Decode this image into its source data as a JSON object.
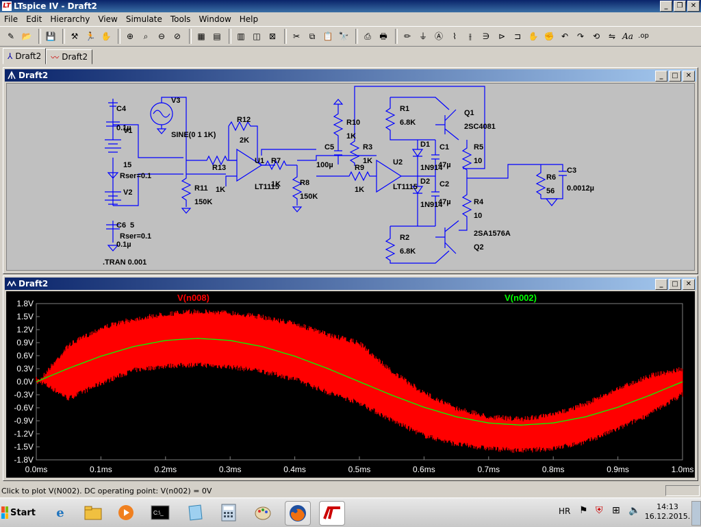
{
  "app": {
    "title": "LTspice IV - Draft2",
    "menu": [
      "File",
      "Edit",
      "Hierarchy",
      "View",
      "Simulate",
      "Tools",
      "Window",
      "Help"
    ],
    "toolbar_icons": [
      "new-schematic-icon",
      "open-icon",
      "save-icon",
      "control-panel-icon",
      "run-icon",
      "halt-icon",
      "zoom-in-icon",
      "zoom-full-icon",
      "zoom-out-icon",
      "autoscale-icon",
      "tile-icon",
      "cascade-icon",
      "close-all-icon",
      "cut-icon",
      "copy-icon",
      "paste-icon",
      "find-icon",
      "print-setup-icon",
      "print-icon",
      "wire-icon",
      "ground-icon",
      "label-icon",
      "resistor-icon",
      "capacitor-icon",
      "inductor-icon",
      "diode-icon",
      "component-icon",
      "move-icon",
      "drag-icon",
      "undo-icon",
      "redo-icon",
      "rotate-icon",
      "mirror-icon",
      "text-icon",
      "spice-directive-icon"
    ],
    "tabs": [
      {
        "label": "Draft2",
        "icon": "schematic-icon"
      },
      {
        "label": "Draft2",
        "icon": "waveform-icon"
      }
    ]
  },
  "schematic_window": {
    "title": "Draft2",
    "labels": {
      "C4": "C4",
      "C4v": "0.1µ",
      "V3": "V3",
      "V3v": "SINE(0 1 1K)",
      "V1": "V1",
      "V1v": "15",
      "V1r": "Rser=0.1",
      "V2": "V2",
      "V2r": "Rser=0.1",
      "C6": "C6",
      "C5b": "5",
      "C6v": "0.1µ",
      "tran": ".TRAN 0.001",
      "R12": "R12",
      "R12v": "2K",
      "R13": "R13",
      "R13v": "1K",
      "R11": "R11",
      "R11v": "150K",
      "U1": "U1",
      "U1v": "LT1115",
      "R7": "R7",
      "R7v": "1K",
      "R8": "R8",
      "R8v": "150K",
      "R10": "R10",
      "R10v": "1K",
      "C5": "C5",
      "C5v": "100µ",
      "R3": "R3",
      "R3v": "1K",
      "R9": "R9",
      "R9v": "1K",
      "U2": "U2",
      "U2v": "LT1115",
      "R1": "R1",
      "R1v": "6.8K",
      "D1": "D1",
      "D1v": "1N914",
      "C1": "C1",
      "C1v": "47µ",
      "D2": "D2",
      "D2v": "1N914",
      "C2": "C2",
      "C2v": "47µ",
      "R2": "R2",
      "R2v": "6.8K",
      "Q1": "Q1",
      "Q1v": "2SC4081",
      "Q2": "Q2",
      "Q2v": "2SA1576A",
      "R5": "R5",
      "R5v": "10",
      "R4": "R4",
      "R4v": "10",
      "R6": "R6",
      "R6v": "56",
      "C3": "C3",
      "C3v": "0.0012µ"
    }
  },
  "plot_window": {
    "title": "Draft2",
    "trace1_label": "V(n008)",
    "trace2_label": "V(n002)",
    "trace1_color": "#ff0000",
    "trace2_color": "#00ff00",
    "yticks": [
      "1.8V",
      "1.5V",
      "1.2V",
      "0.9V",
      "0.6V",
      "0.3V",
      "0.0V",
      "-0.3V",
      "-0.6V",
      "-0.9V",
      "-1.2V",
      "-1.5V",
      "-1.8V"
    ],
    "xticks": [
      "0.0ms",
      "0.1ms",
      "0.2ms",
      "0.3ms",
      "0.4ms",
      "0.5ms",
      "0.6ms",
      "0.7ms",
      "0.8ms",
      "0.9ms",
      "1.0ms"
    ]
  },
  "chart_data": {
    "type": "line",
    "title": "",
    "xlabel": "",
    "ylabel": "",
    "xlim": [
      0,
      1.0
    ],
    "ylim": [
      -1.8,
      1.8
    ],
    "x_unit": "ms",
    "y_unit": "V",
    "grid": false,
    "series": [
      {
        "name": "V(n008)",
        "color": "#ff0000",
        "x": [
          0.0,
          0.05,
          0.1,
          0.15,
          0.2,
          0.25,
          0.3,
          0.35,
          0.4,
          0.45,
          0.5,
          0.55,
          0.6,
          0.65,
          0.7,
          0.75,
          0.8,
          0.85,
          0.9,
          0.95,
          1.0
        ],
        "upper": [
          0.0,
          0.9,
          1.3,
          1.5,
          1.62,
          1.68,
          1.65,
          1.55,
          1.4,
          1.15,
          0.95,
          0.3,
          -0.2,
          -0.55,
          -0.75,
          -0.8,
          -0.7,
          -0.45,
          -0.1,
          0.2,
          0.35
        ],
        "lower": [
          0.0,
          -0.45,
          -0.1,
          0.2,
          0.3,
          0.33,
          0.28,
          0.18,
          0.0,
          -0.3,
          -0.55,
          -0.95,
          -1.3,
          -1.5,
          -1.6,
          -1.65,
          -1.6,
          -1.45,
          -1.15,
          -0.8,
          -0.35
        ]
      },
      {
        "name": "V(n002)",
        "color": "#00ff00",
        "x": [
          0.0,
          0.05,
          0.1,
          0.15,
          0.2,
          0.25,
          0.3,
          0.35,
          0.4,
          0.45,
          0.5,
          0.55,
          0.6,
          0.65,
          0.7,
          0.75,
          0.8,
          0.85,
          0.9,
          0.95,
          1.0
        ],
        "values": [
          0.0,
          0.309,
          0.588,
          0.809,
          0.951,
          1.0,
          0.951,
          0.809,
          0.588,
          0.309,
          0.0,
          -0.309,
          -0.588,
          -0.809,
          -0.951,
          -1.0,
          -0.951,
          -0.809,
          -0.588,
          -0.309,
          0.0
        ]
      }
    ]
  },
  "status": {
    "text": "Click to plot V(N002).  DC operating point: V(n002) = 0V"
  },
  "taskbar": {
    "start_label": "Start",
    "apps": [
      "ie-icon",
      "explorer-icon",
      "media-player-icon",
      "cmd-icon",
      "notepad-icon",
      "calculator-icon",
      "paint-icon",
      "firefox-icon",
      "ltspice-icon"
    ],
    "lang": "HR",
    "time": "14:13",
    "date": "16.12.2015."
  }
}
